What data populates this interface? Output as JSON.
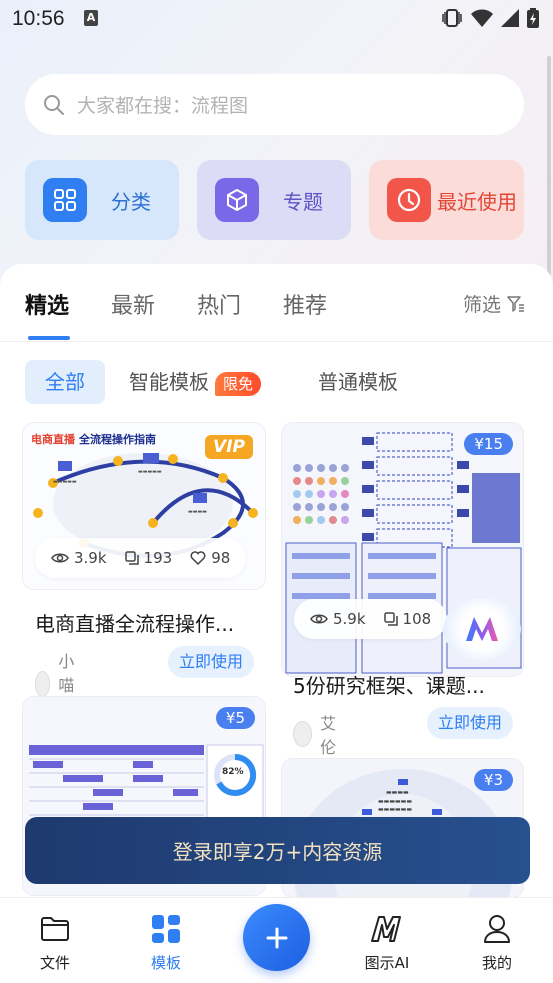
{
  "status_bar": {
    "time": "10:56",
    "notification_letter": "A"
  },
  "search": {
    "placeholder": "大家都在搜：流程图"
  },
  "quick_actions": [
    {
      "label": "分类",
      "icon": "grid-icon"
    },
    {
      "label": "专题",
      "icon": "cube-icon"
    },
    {
      "label": "最近使用",
      "icon": "clock-icon"
    }
  ],
  "tabs": [
    "精选",
    "最新",
    "热门",
    "推荐"
  ],
  "filter": {
    "label": "筛选"
  },
  "subtabs": {
    "all": "全部",
    "smart": "智能模板",
    "limited_badge": "限免",
    "normal": "普通模板"
  },
  "cards": [
    {
      "thumb_title_red": "电商直播",
      "thumb_title": "全流程操作指南",
      "vip": "VIP",
      "views": "3.9k",
      "copies": "193",
      "likes": "98",
      "title": "电商直播全流程操作...",
      "author": "小喵姐",
      "use_label": "立即使用"
    },
    {
      "price": "¥15",
      "views": "5.9k",
      "copies": "108",
      "title": "5份研究框架、课题...",
      "author": "艾伦",
      "use_label": "立即使用"
    },
    {
      "price": "¥5",
      "gauge_value": "82%"
    },
    {
      "price": "¥3"
    }
  ],
  "login_banner": {
    "text": "登录即享2万+内容资源"
  },
  "bottom_nav": [
    {
      "label": "文件",
      "icon": "folder-icon"
    },
    {
      "label": "模板",
      "icon": "template-icon"
    },
    {
      "label": "图示AI",
      "icon": "ai-logo-icon"
    },
    {
      "label": "我的",
      "icon": "user-icon"
    }
  ],
  "colors": {
    "accent": "#2f7ef2",
    "qc_blue_bg": "#d7e7fb",
    "qc_purple_bg": "#dcdcf7",
    "qc_red_bg": "#fbdcd8",
    "banner_bg": "#1e3a6e",
    "banner_text": "#f3e2c0"
  }
}
